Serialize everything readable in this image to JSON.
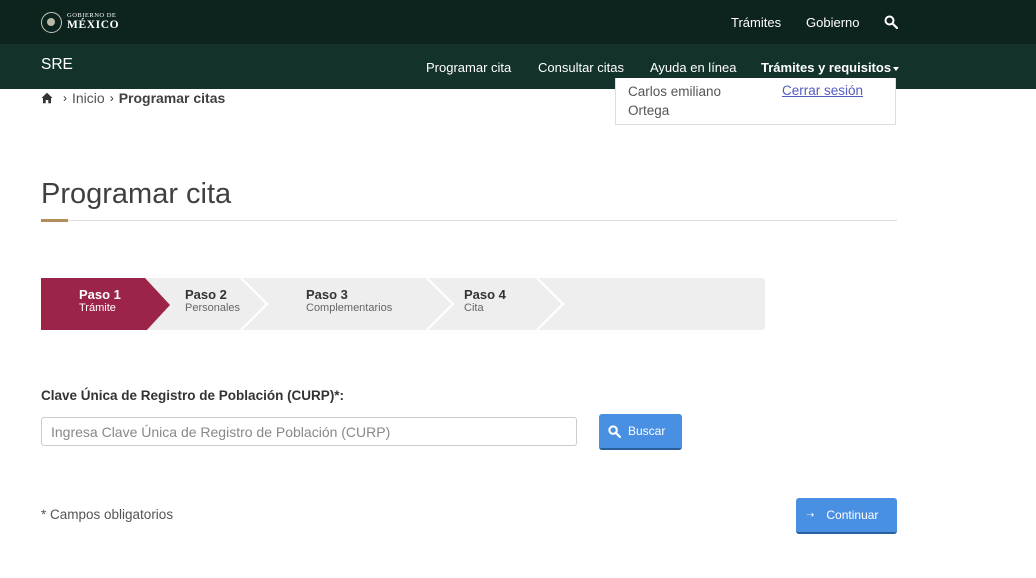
{
  "gov_bar": {
    "logo_line1": "GOBIERNO DE",
    "logo_line2": "MÉXICO",
    "nav": [
      "Trámites",
      "Gobierno"
    ],
    "search_icon": "search-icon"
  },
  "sre_bar": {
    "title": "SRE",
    "nav": [
      "Programar cita",
      "Consultar citas",
      "Ayuda en línea",
      "Trámites y requisitos"
    ]
  },
  "breadcrumb": {
    "home_icon": "home-icon",
    "items": [
      "Inicio",
      "Programar citas"
    ]
  },
  "user": {
    "name": "Carlos emiliano Ortega",
    "logout": "Cerrar sesión"
  },
  "page": {
    "title": "Programar cita"
  },
  "steps": [
    {
      "num": "Paso 1",
      "label": "Trámite",
      "active": true
    },
    {
      "num": "Paso 2",
      "label": "Personales",
      "active": false
    },
    {
      "num": "Paso 3",
      "label": "Complementarios",
      "active": false
    },
    {
      "num": "Paso 4",
      "label": "Cita",
      "active": false
    }
  ],
  "form": {
    "curp_label": "Clave Única de Registro de Población (CURP)*:",
    "curp_placeholder": "Ingresa Clave Única de Registro de Población (CURP)",
    "curp_value": "",
    "search_button": "Buscar",
    "required_note": "* Campos obligatorios",
    "continue_button": "Continuar"
  },
  "colors": {
    "gov_bar": "#0c231e",
    "sre_bar": "#13322b",
    "active_step": "#9d2449",
    "accent": "#b38e5d",
    "button": "#4a90e2"
  }
}
